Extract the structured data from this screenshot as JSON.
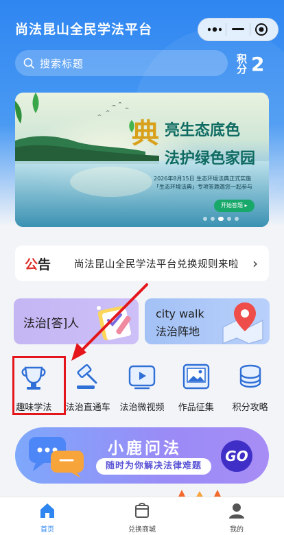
{
  "app": {
    "title": "尚法昆山全民学法平台"
  },
  "capsule": {
    "more_icon": "more-dots-icon",
    "minimize_icon": "minimize-icon",
    "close_icon": "target-close-icon"
  },
  "search": {
    "placeholder": "搜索标题",
    "icon": "search-icon"
  },
  "points": {
    "label": "积分",
    "value": "2"
  },
  "banner": {
    "badge": "典",
    "line1": "亮生态底色",
    "line2": "法护绿色家园",
    "sub1": "2026年8月15日 生态环境法典正式实施",
    "sub2": "「生态环境法典」专项答题邀您一起参与",
    "button": "开始答题 ▸",
    "active_dot": 3
  },
  "notice": {
    "tag_prefix": "公",
    "tag_suffix": "告",
    "text": "尚法昆山全民学法平台兑换规则来啦",
    "chevron": "›"
  },
  "cards": [
    {
      "label": "法治[答]人"
    },
    {
      "line1": "city walk",
      "line2": "法治阵地"
    }
  ],
  "icons": [
    {
      "name": "trophy-icon",
      "label": "趣味学法"
    },
    {
      "name": "gavel-icon",
      "label": "法治直通车"
    },
    {
      "name": "video-icon",
      "label": "法治微视频"
    },
    {
      "name": "picture-icon",
      "label": "作品征集"
    },
    {
      "name": "coins-icon",
      "label": "积分攻略"
    }
  ],
  "xiaolu": {
    "title": "小鹿问法",
    "subtitle": "随时为你解决法律难题",
    "go": "GO"
  },
  "tabbar": [
    {
      "label": "首页",
      "icon": "home-icon",
      "active": true
    },
    {
      "label": "兑换商城",
      "icon": "shop-icon",
      "active": false
    },
    {
      "label": "我的",
      "icon": "profile-icon",
      "active": false
    }
  ],
  "colors": {
    "primary": "#2f86f1",
    "highlight": "#e4161b",
    "notice_red": "#e0322b"
  }
}
